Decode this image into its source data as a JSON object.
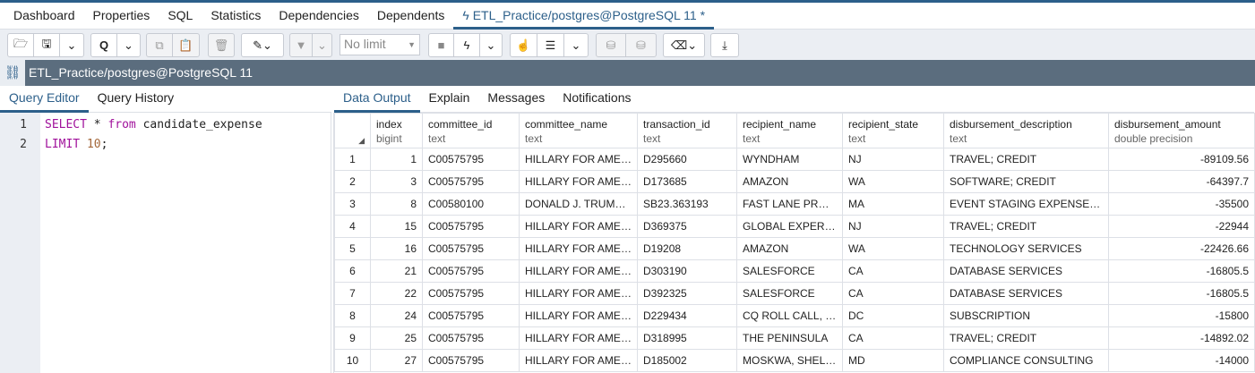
{
  "tabs": [
    "Dashboard",
    "Properties",
    "SQL",
    "Statistics",
    "Dependencies",
    "Dependents"
  ],
  "active_tab": "ETL_Practice/postgres@PostgreSQL 11 *",
  "toolbar": {
    "limit": "No limit"
  },
  "connection": "ETL_Practice/postgres@PostgreSQL 11",
  "left_tabs": [
    "Query Editor",
    "Query History"
  ],
  "right_tabs": [
    "Data Output",
    "Explain",
    "Messages",
    "Notifications"
  ],
  "editor": {
    "line_numbers": [
      "1",
      "2"
    ],
    "l1_kw1": "SELECT",
    "l1_rest1": " * ",
    "l1_kw2": "from",
    "l1_rest2": " candidate_expense",
    "l2_kw": "LIMIT",
    "l2_num": "10",
    "l2_end": ";"
  },
  "columns": [
    {
      "name": "index",
      "type": "bigint"
    },
    {
      "name": "committee_id",
      "type": "text"
    },
    {
      "name": "committee_name",
      "type": "text"
    },
    {
      "name": "transaction_id",
      "type": "text"
    },
    {
      "name": "recipient_name",
      "type": "text"
    },
    {
      "name": "recipient_state",
      "type": "text"
    },
    {
      "name": "disbursement_description",
      "type": "text"
    },
    {
      "name": "disbursement_amount",
      "type": "double precision"
    }
  ],
  "rows": [
    [
      "1",
      "1",
      "C00575795",
      "HILLARY FOR AMERICA",
      "D295660",
      "WYNDHAM",
      "NJ",
      "TRAVEL; CREDIT",
      "-89109.56"
    ],
    [
      "2",
      "3",
      "C00575795",
      "HILLARY FOR AMERICA",
      "D173685",
      "AMAZON",
      "WA",
      "SOFTWARE; CREDIT",
      "-64397.7"
    ],
    [
      "3",
      "8",
      "C00580100",
      "DONALD J. TRUMP FOR PRESIDENT",
      "SB23.363193",
      "FAST LANE PRODUCTIONS",
      "MA",
      "EVENT STAGING EXPENSE - PRODUCTION",
      "-35500"
    ],
    [
      "4",
      "15",
      "C00575795",
      "HILLARY FOR AMERICA",
      "D369375",
      "GLOBAL EXPERIENCE",
      "NJ",
      "TRAVEL; CREDIT",
      "-22944"
    ],
    [
      "5",
      "16",
      "C00575795",
      "HILLARY FOR AMERICA",
      "D19208",
      "AMAZON",
      "WA",
      "TECHNOLOGY SERVICES",
      "-22426.66"
    ],
    [
      "6",
      "21",
      "C00575795",
      "HILLARY FOR AMERICA",
      "D303190",
      "SALESFORCE",
      "CA",
      "DATABASE SERVICES",
      "-16805.5"
    ],
    [
      "7",
      "22",
      "C00575795",
      "HILLARY FOR AMERICA",
      "D392325",
      "SALESFORCE",
      "CA",
      "DATABASE SERVICES",
      "-16805.5"
    ],
    [
      "8",
      "24",
      "C00575795",
      "HILLARY FOR AMERICA",
      "D229434",
      "CQ ROLL CALL, INC.",
      "DC",
      "SUBSCRIPTION",
      "-15800"
    ],
    [
      "9",
      "25",
      "C00575795",
      "HILLARY FOR AMERICA",
      "D318995",
      "THE PENINSULA",
      "CA",
      "TRAVEL; CREDIT",
      "-14892.02"
    ],
    [
      "10",
      "27",
      "C00575795",
      "HILLARY FOR AMERICA",
      "D185002",
      "MOSKWA, SHELLY",
      "MD",
      "COMPLIANCE CONSULTING",
      "-14000"
    ]
  ]
}
